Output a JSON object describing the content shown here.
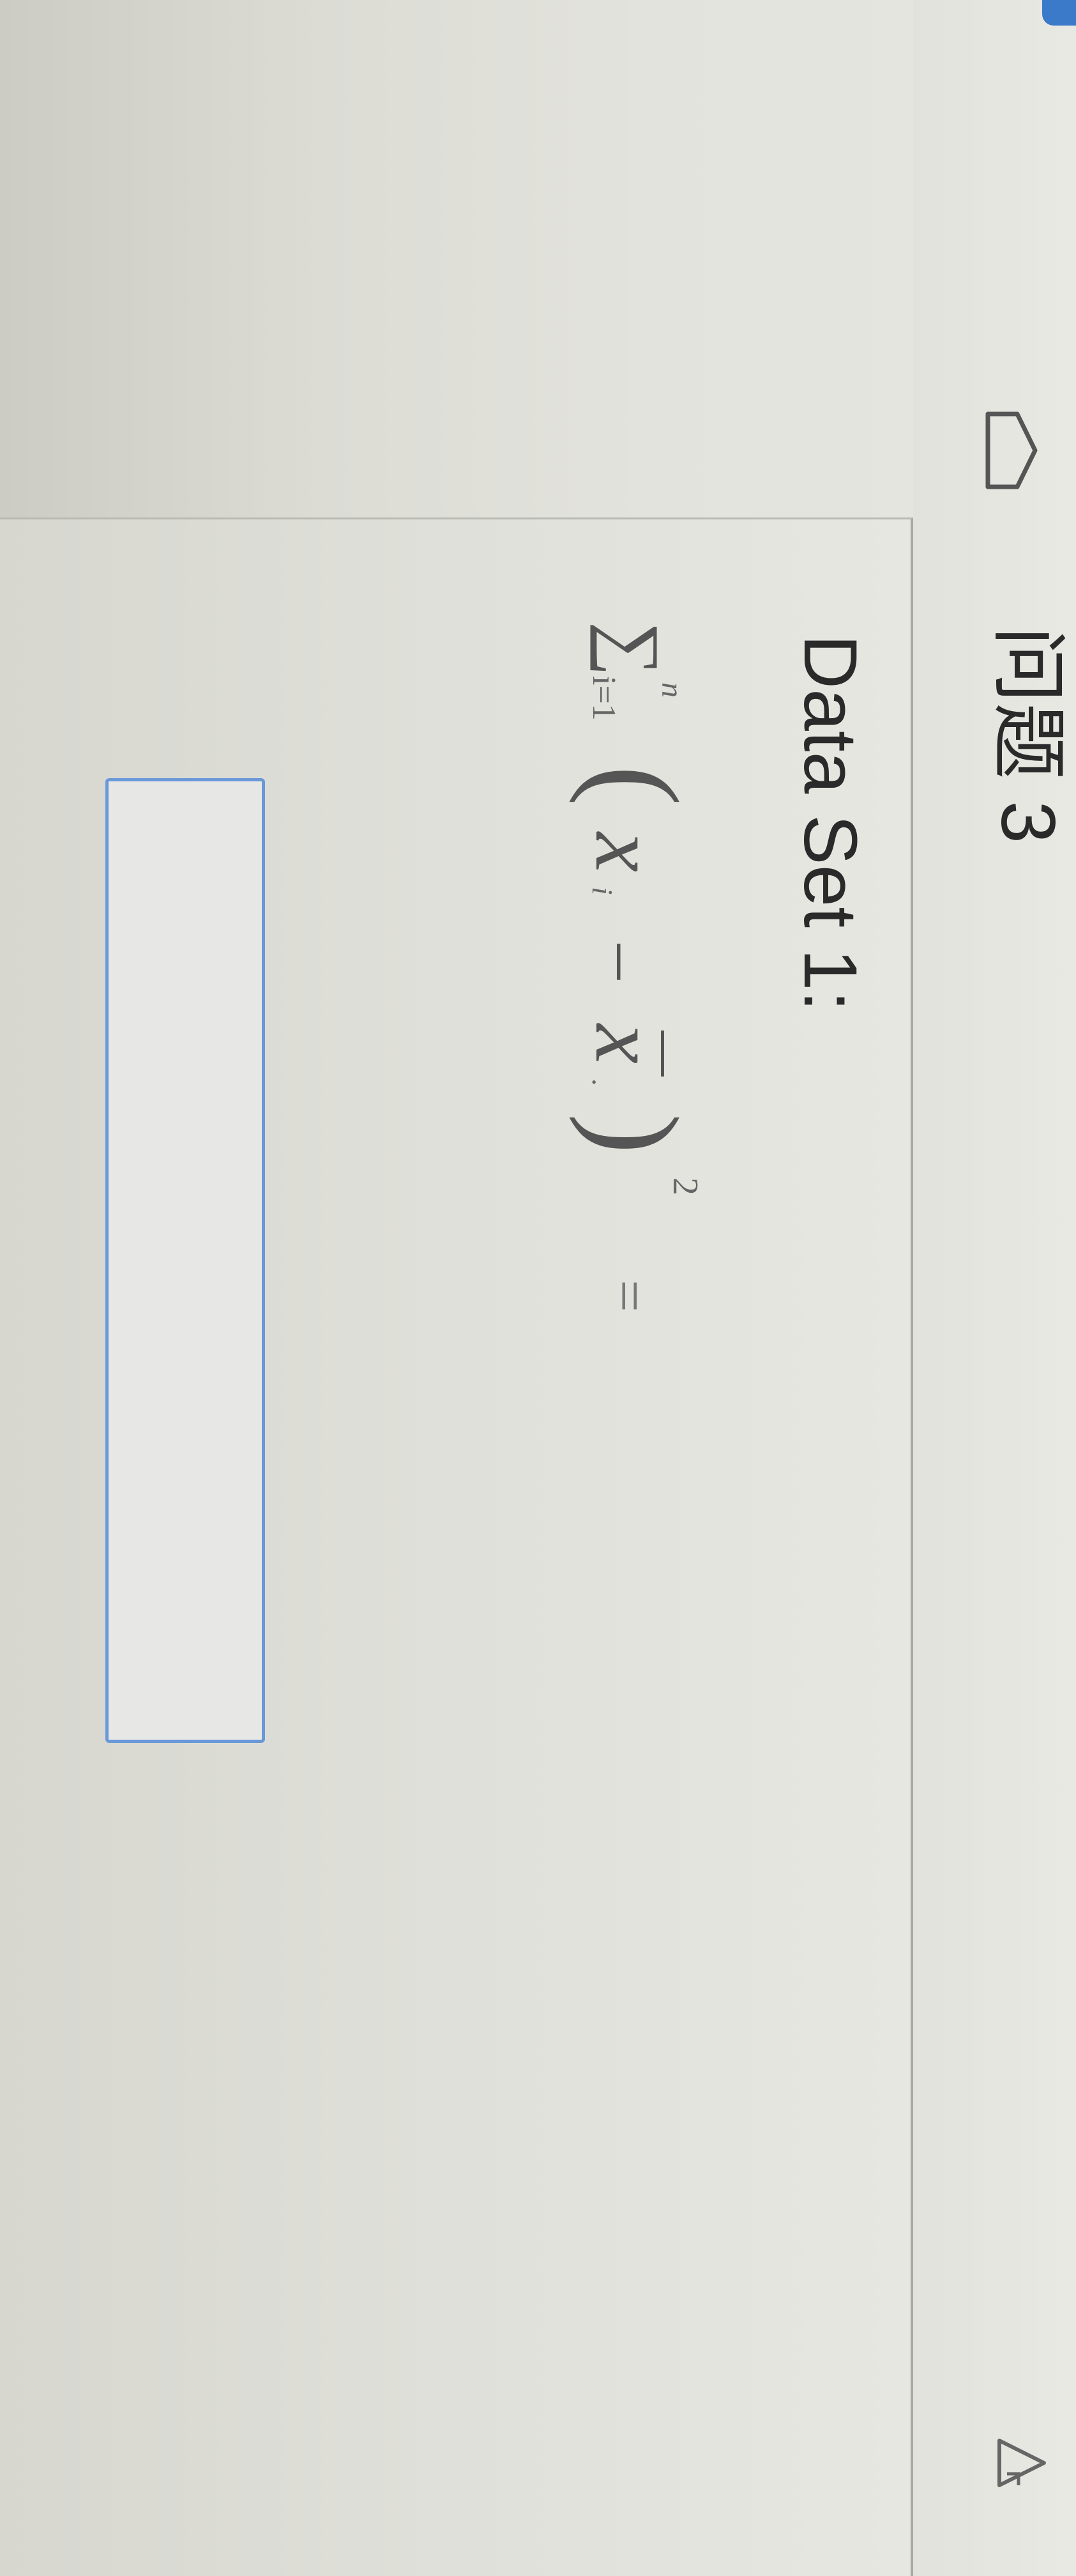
{
  "header": {
    "question_title": "问题 3"
  },
  "question": {
    "dataset_label": "Data Set 1:",
    "formula": {
      "sigma": "∑",
      "upper_limit": "n",
      "lower_limit": "i=1",
      "open_paren": "(",
      "variable": "x",
      "variable_subscript": "i",
      "minus": "–",
      "mean_variable": "x",
      "mean_subscript": ".",
      "close_paren": ")",
      "exponent": "2",
      "equals": "="
    },
    "answer": {
      "value": "",
      "placeholder": ""
    }
  },
  "icons": {
    "flag": "bookmark-flag-icon",
    "resize": "resize-handle-icon"
  },
  "colors": {
    "input_border": "#6a98d8",
    "badge": "#3a7ac8"
  }
}
